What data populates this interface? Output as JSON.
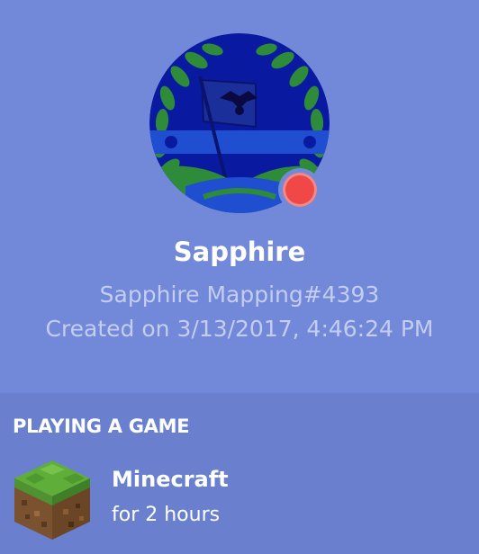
{
  "profile": {
    "username": "Sapphire",
    "tag": "Sapphire Mapping#4393",
    "created": "Created on 3/13/2017, 4:46:24 PM",
    "status": "do-not-disturb",
    "status_color": "#f04747"
  },
  "activity": {
    "heading": "PLAYING A GAME",
    "game_name": "Minecraft",
    "game_time": "for 2 hours",
    "game_icon": "grass-block-icon"
  },
  "colors": {
    "background": "#7289da",
    "activity_background": "#6a80cf",
    "text_muted": "#c4cdef"
  }
}
